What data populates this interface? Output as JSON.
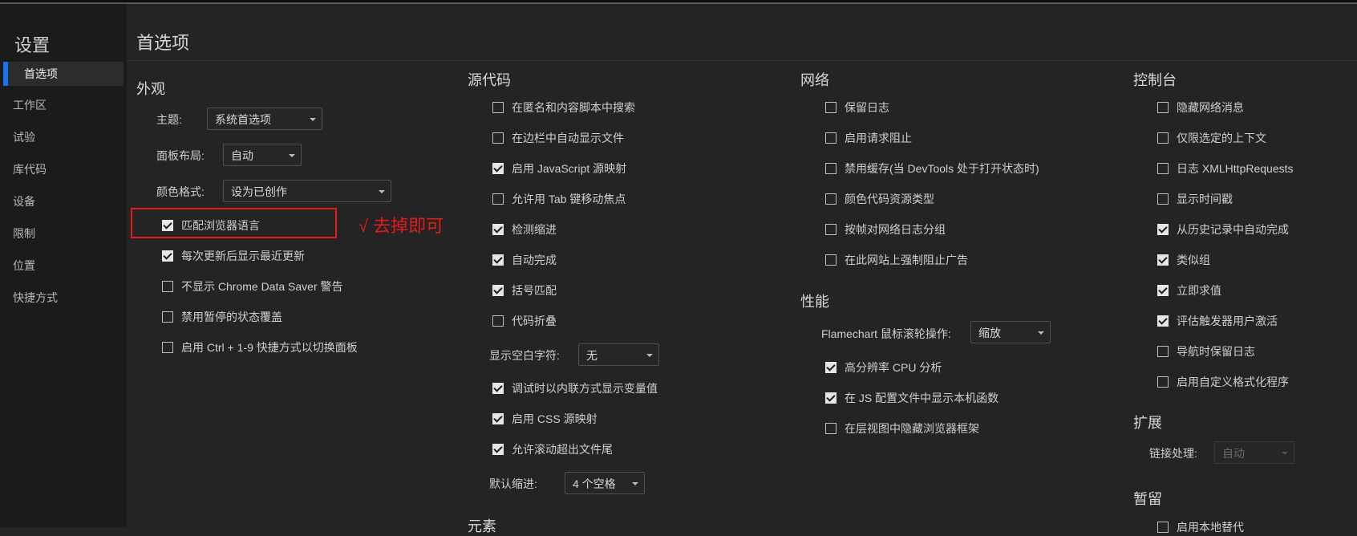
{
  "sidebar": {
    "title": "设置",
    "items": [
      {
        "label": "首选项",
        "active": true
      },
      {
        "label": "工作区"
      },
      {
        "label": "试验"
      },
      {
        "label": "库代码"
      },
      {
        "label": "设备"
      },
      {
        "label": "限制"
      },
      {
        "label": "位置"
      },
      {
        "label": "快捷方式"
      }
    ]
  },
  "page": {
    "title": "首选项"
  },
  "appearance": {
    "heading": "外观",
    "theme_label": "主题:",
    "theme_value": "系统首选项",
    "layout_label": "面板布局:",
    "layout_value": "自动",
    "color_label": "颜色格式:",
    "color_value": "设为已创作",
    "options": [
      {
        "label": "匹配浏览器语言",
        "checked": true
      },
      {
        "label": "每次更新后显示最近更新",
        "checked": true
      },
      {
        "label": "不显示 Chrome Data Saver 警告",
        "checked": false
      },
      {
        "label": "禁用暂停的状态覆盖",
        "checked": false
      },
      {
        "label": "启用 Ctrl + 1-9 快捷方式以切换面板",
        "checked": false
      }
    ]
  },
  "annotation": {
    "text": "√ 去掉即可"
  },
  "sources": {
    "heading": "源代码",
    "options": [
      {
        "label": "在匿名和内容脚本中搜索",
        "checked": false
      },
      {
        "label": "在边栏中自动显示文件",
        "checked": false
      },
      {
        "label": "启用 JavaScript 源映射",
        "checked": true
      },
      {
        "label": "允许用 Tab 键移动焦点",
        "checked": false
      },
      {
        "label": "检测缩进",
        "checked": true
      },
      {
        "label": "自动完成",
        "checked": true
      },
      {
        "label": "括号匹配",
        "checked": true
      },
      {
        "label": "代码折叠",
        "checked": false
      }
    ],
    "whitespace_label": "显示空白字符:",
    "whitespace_value": "无",
    "options2": [
      {
        "label": "调试时以内联方式显示变量值",
        "checked": true
      },
      {
        "label": "启用 CSS 源映射",
        "checked": true
      },
      {
        "label": "允许滚动超出文件尾",
        "checked": true
      }
    ],
    "indent_label": "默认缩进:",
    "indent_value": "4 个空格"
  },
  "elements": {
    "heading": "元素"
  },
  "network": {
    "heading": "网络",
    "options": [
      {
        "label": "保留日志",
        "checked": false
      },
      {
        "label": "启用请求阻止",
        "checked": false
      },
      {
        "label": "禁用缓存(当 DevTools 处于打开状态时)",
        "checked": false
      },
      {
        "label": "颜色代码资源类型",
        "checked": false
      },
      {
        "label": "按帧对网络日志分组",
        "checked": false
      },
      {
        "label": "在此网站上强制阻止广告",
        "checked": false
      }
    ]
  },
  "performance": {
    "heading": "性能",
    "flame_label": "Flamechart 鼠标滚轮操作:",
    "flame_value": "缩放",
    "options": [
      {
        "label": "高分辨率 CPU 分析",
        "checked": true
      },
      {
        "label": "在 JS 配置文件中显示本机函数",
        "checked": true
      },
      {
        "label": "在层视图中隐藏浏览器框架",
        "checked": false
      }
    ]
  },
  "console": {
    "heading": "控制台",
    "options": [
      {
        "label": "隐藏网络消息",
        "checked": false
      },
      {
        "label": "仅限选定的上下文",
        "checked": false
      },
      {
        "label": "日志 XMLHttpRequests",
        "checked": false
      },
      {
        "label": "显示时间戳",
        "checked": false
      },
      {
        "label": "从历史记录中自动完成",
        "checked": true
      },
      {
        "label": "类似组",
        "checked": true
      },
      {
        "label": "立即求值",
        "checked": true
      },
      {
        "label": "评估触发器用户激活",
        "checked": true
      },
      {
        "label": "导航时保留日志",
        "checked": false
      },
      {
        "label": "启用自定义格式化程序",
        "checked": false
      }
    ]
  },
  "extensions": {
    "heading": "扩展",
    "link_label": "链接处理:",
    "link_value": "自动"
  },
  "persistence": {
    "heading": "暂留",
    "options": [
      {
        "label": "启用本地替代",
        "checked": false
      }
    ]
  }
}
